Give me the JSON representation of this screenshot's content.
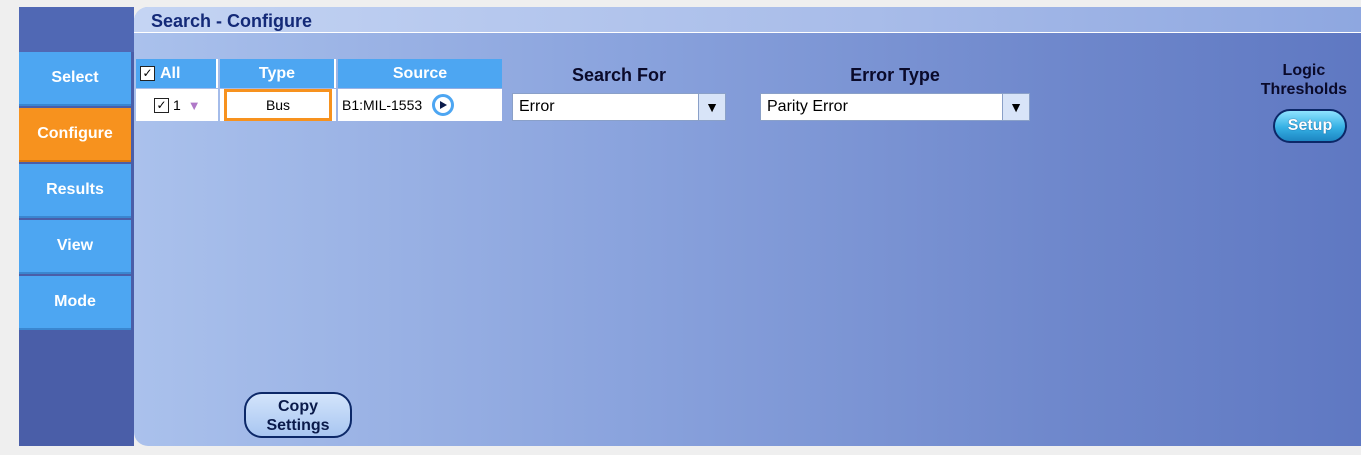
{
  "title": "Search - Configure",
  "nav": {
    "select": "Select",
    "configure": "Configure",
    "results": "Results",
    "view": "View",
    "mode": "Mode"
  },
  "table": {
    "headers": {
      "all": "All",
      "type": "Type",
      "source": "Source"
    },
    "row": {
      "index": "1",
      "type": "Bus",
      "source": "B1:MIL-1553"
    }
  },
  "search_for": {
    "label": "Search For",
    "value": "Error"
  },
  "error_type": {
    "label": "Error Type",
    "value": "Parity Error"
  },
  "logic_thresholds": {
    "line1": "Logic",
    "line2": "Thresholds",
    "button": "Setup"
  },
  "copy_settings": {
    "line1": "Copy",
    "line2": "Settings"
  },
  "colors": {
    "accent_orange": "#f7921e",
    "nav_blue": "#4da6f2",
    "title_text": "#142a78"
  }
}
